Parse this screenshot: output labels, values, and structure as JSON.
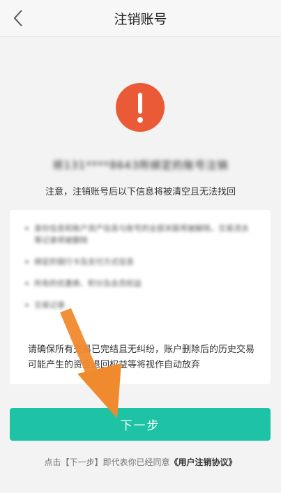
{
  "header": {
    "title": "注销账号",
    "back_icon": "chevron-left-icon"
  },
  "alert": {
    "icon": "exclamation-icon",
    "color": "#ea5a37"
  },
  "account_line": "将131****8643所绑定的账号注销",
  "notice": "注意，注销账号后以下信息将被清空且无法找回",
  "card": {
    "items": [
      "身份信息和账户资产信息与账号的全部关联将被解除，交易流水等记录将被删除",
      "绑定的银行卡及支付方式信息",
      "所有的优惠券、积分及会员权益",
      "交易记录"
    ],
    "warning": "请确保所有交易已完结且无纠纷，账户删除后的历史交易可能产生的资金退回权益等将视作自动放弃"
  },
  "next_button": {
    "label": "下一步",
    "color": "#1ec3a6"
  },
  "agreement": {
    "prefix": "点击【下一步】即代表你已经同意",
    "link": "《用户注销协议》"
  },
  "annotation": {
    "arrow_color": "#f08a2e"
  }
}
